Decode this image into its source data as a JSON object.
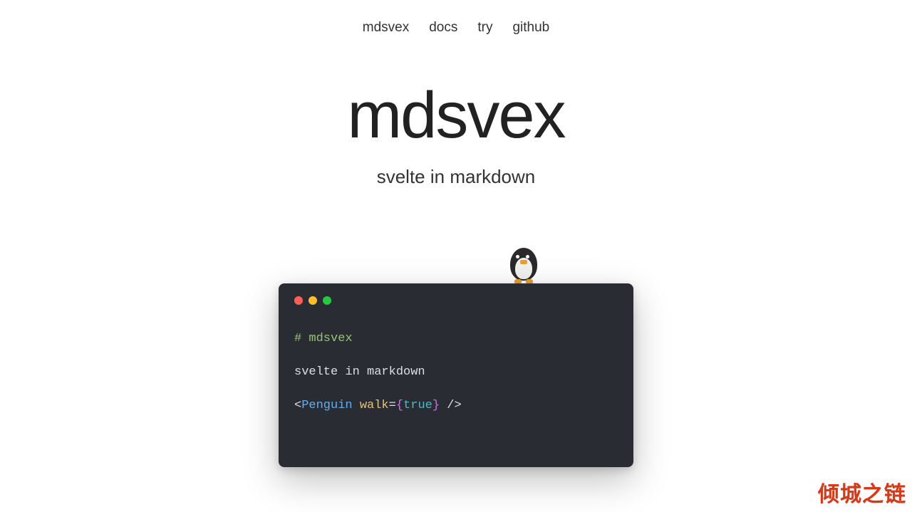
{
  "nav": {
    "items": [
      {
        "label": "mdsvex"
      },
      {
        "label": "docs"
      },
      {
        "label": "try"
      },
      {
        "label": "github"
      }
    ]
  },
  "hero": {
    "title": "mdsvex",
    "subtitle": "svelte in markdown"
  },
  "terminal": {
    "lines": {
      "heading": "# mdsvex",
      "text": "svelte in markdown",
      "open": "<",
      "tag": "Penguin",
      "space": " ",
      "attr": "walk",
      "eq": "=",
      "lbrace": "{",
      "bool": "true",
      "rbrace": "}",
      "close": " />"
    }
  },
  "watermark": "倾城之链"
}
